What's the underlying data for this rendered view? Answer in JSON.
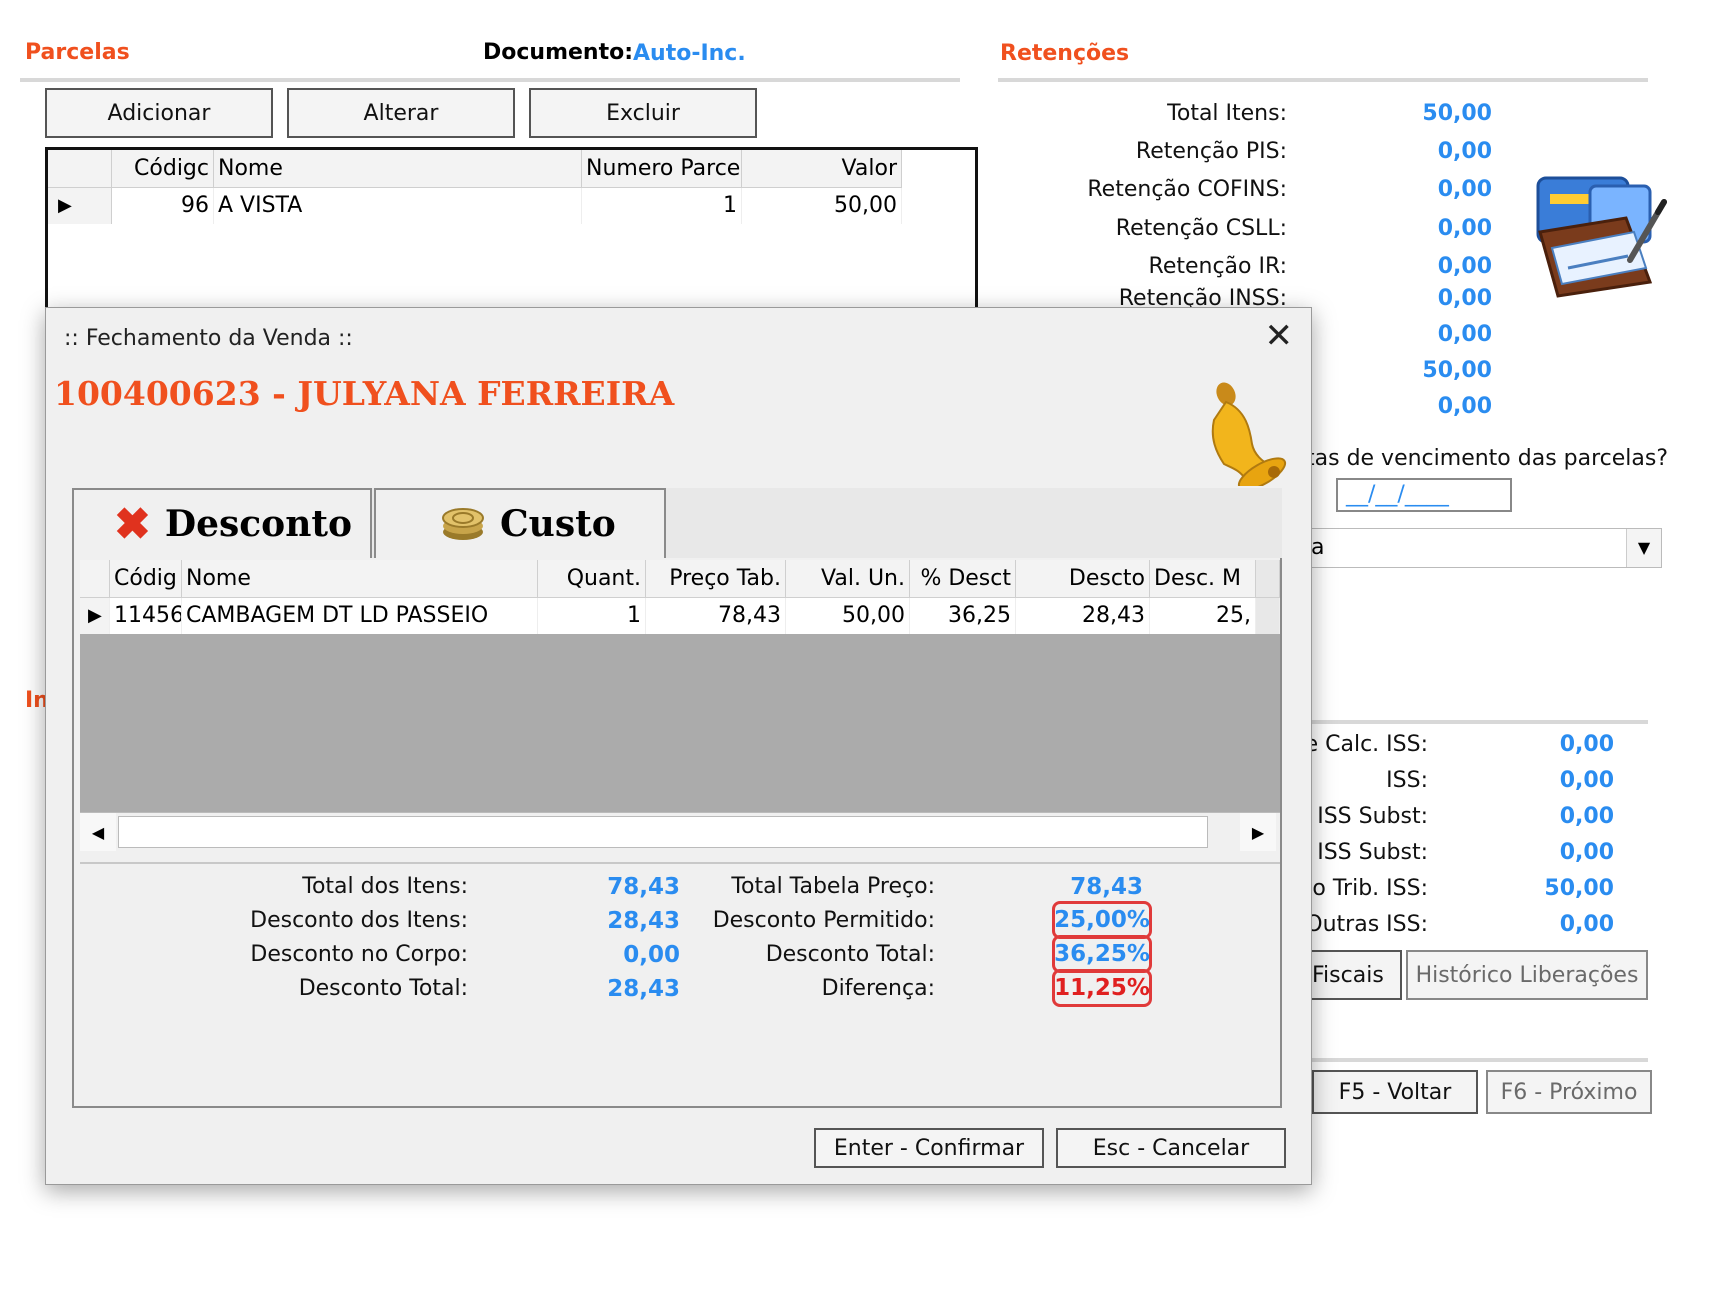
{
  "parcelas": {
    "title": "Parcelas",
    "documento_label": "Documento:",
    "documento_value": "Auto-Inc.",
    "buttons": {
      "adicionar": "Adicionar",
      "alterar": "Alterar",
      "excluir": "Excluir"
    },
    "grid": {
      "columns": [
        "Códigc",
        "Nome",
        "Numero Parcel",
        "Valor"
      ],
      "rows": [
        {
          "codigo": "96",
          "nome": "A  VISTA",
          "numero": "1",
          "valor": "50,00"
        }
      ]
    }
  },
  "retencoes": {
    "title": "Retenções",
    "rows": [
      {
        "label": "Total Itens:",
        "value": "50,00"
      },
      {
        "label": "Retenção PIS:",
        "value": "0,00"
      },
      {
        "label": "Retenção COFINS:",
        "value": "0,00"
      },
      {
        "label": "Retenção CSLL:",
        "value": "0,00"
      },
      {
        "label": "Retenção IR:",
        "value": "0,00"
      },
      {
        "label": "Retenção INSS:",
        "value": "0,00"
      }
    ],
    "extra_values": [
      "0,00",
      "50,00",
      "0,00"
    ],
    "question_fragment": "tas de vencimento das parcelas?",
    "date_mask": "__/__/____",
    "combo_fragment": "a"
  },
  "left_fragment": "In",
  "iss": {
    "rows": [
      {
        "label": "e Calc. ISS:",
        "value": "0,00"
      },
      {
        "label": "ISS:",
        "value": "0,00"
      },
      {
        "label": "ISS Subst:",
        "value": "0,00"
      },
      {
        "label": "ISS Subst:",
        "value": "0,00"
      },
      {
        "label": "o Trib. ISS:",
        "value": "50,00"
      },
      {
        "label": "Outras ISS:",
        "value": "0,00"
      }
    ],
    "buttons": {
      "fiscais": "Fiscais",
      "historico": "Histórico Liberações"
    }
  },
  "nav": {
    "voltar": "F5 - Voltar",
    "proximo": "F6 - Próximo"
  },
  "dialog": {
    "title": ":: Fechamento da Venda ::",
    "close": "✕",
    "customer": "100400623 - JULYANA FERREIRA",
    "tabs": {
      "desconto": "Desconto",
      "custo": "Custo"
    },
    "grid": {
      "columns": [
        "Códig",
        "Nome",
        "Quant.",
        "Preço Tab.",
        "Val. Un.",
        "% Desct",
        "Descto",
        "Desc. M"
      ],
      "rows": [
        {
          "codigo": "11456",
          "nome": "CAMBAGEM DT LD PASSEIO",
          "quant": "1",
          "preco_tab": "78,43",
          "val_un": "50,00",
          "pct_desct": "36,25",
          "descto": "28,43",
          "desc_m": "25,"
        }
      ]
    },
    "summary_left": [
      {
        "label": "Total dos Itens:",
        "value": "78,43"
      },
      {
        "label": "Desconto dos Itens:",
        "value": "28,43"
      },
      {
        "label": "Desconto no Corpo:",
        "value": "0,00"
      },
      {
        "label": "Desconto Total:",
        "value": "28,43"
      }
    ],
    "summary_right": [
      {
        "label": "Total Tabela Preço:",
        "value": "78,43"
      },
      {
        "label": "Desconto Permitido:",
        "value": "25,00%"
      },
      {
        "label": "Desconto Total:",
        "value": "36,25%"
      },
      {
        "label": "Diferença:",
        "value": "11,25%"
      }
    ],
    "buttons": {
      "confirmar": "Enter - Confirmar",
      "cancelar": "Esc - Cancelar"
    },
    "colors": {
      "blue": "#2a8cf0",
      "red": "#e02020",
      "orange": "#f0501e"
    }
  }
}
